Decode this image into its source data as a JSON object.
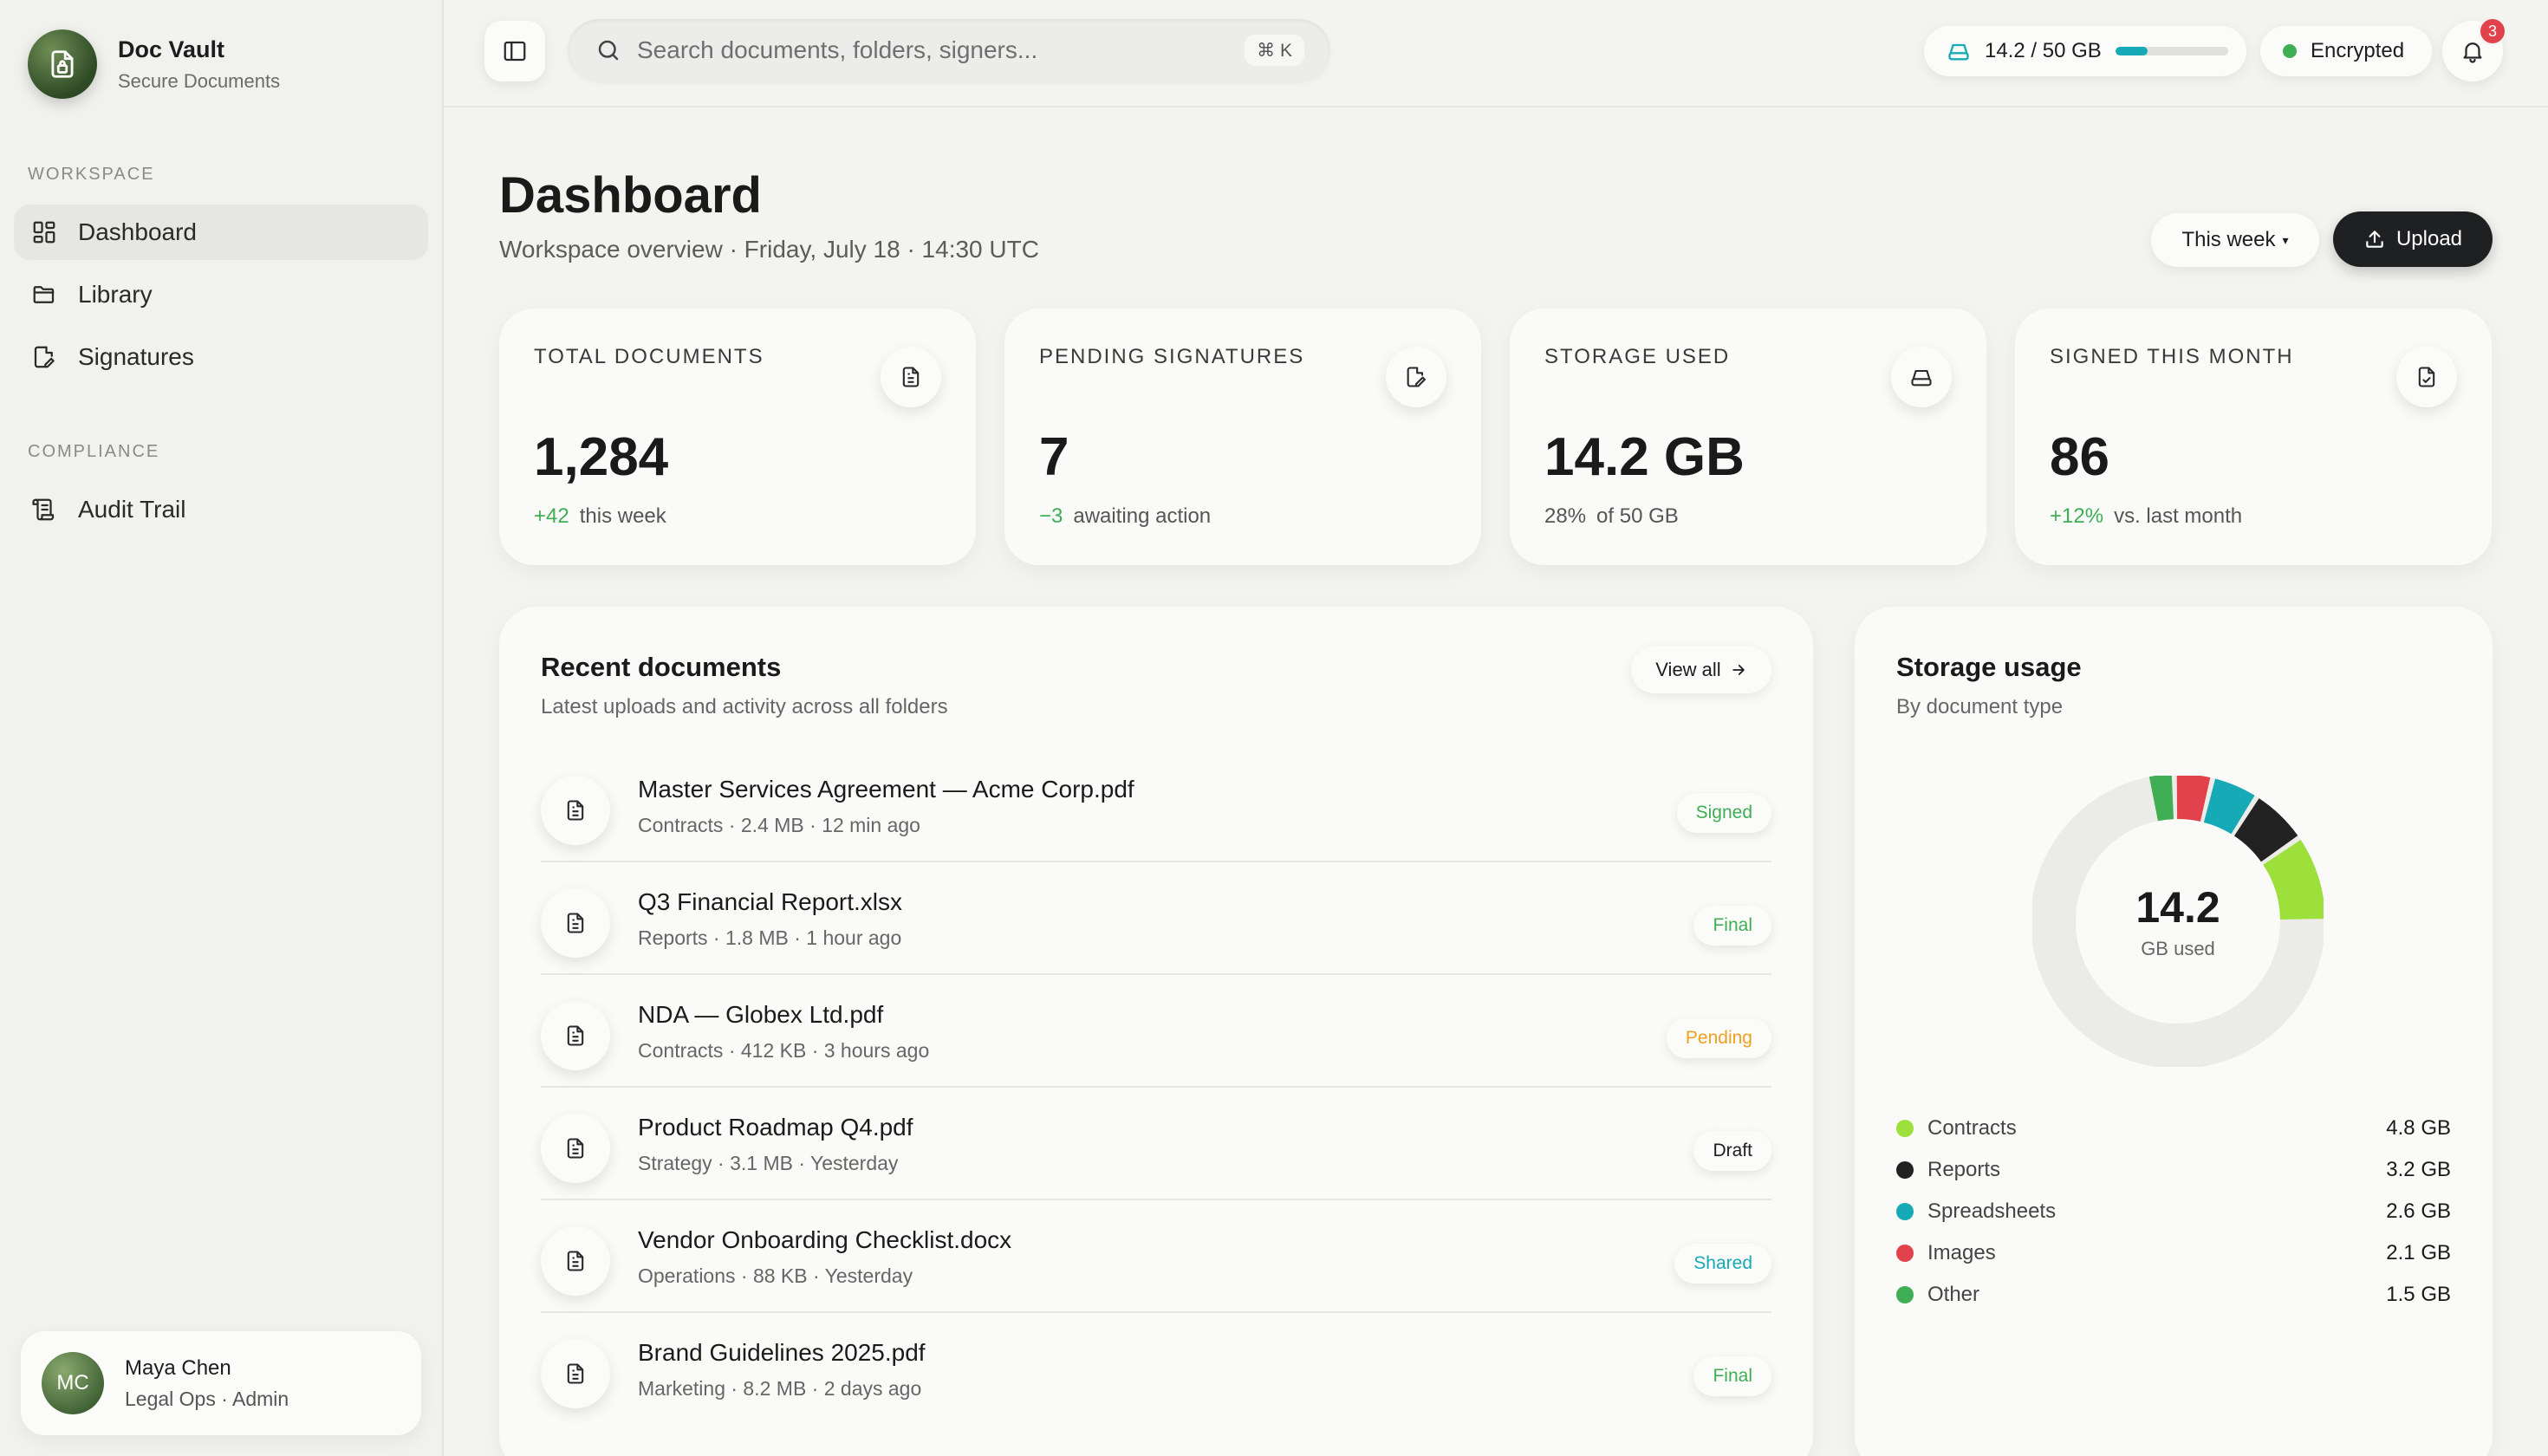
{
  "brand": {
    "name": "Doc Vault",
    "subtitle": "Secure Documents"
  },
  "sidebar": {
    "sections": [
      {
        "title": "WORKSPACE",
        "items": [
          {
            "label": "Dashboard",
            "icon": "grid-icon",
            "active": true
          },
          {
            "label": "Library",
            "icon": "folder-icon",
            "active": false
          },
          {
            "label": "Signatures",
            "icon": "signature-icon",
            "active": false
          }
        ]
      },
      {
        "title": "COMPLIANCE",
        "items": [
          {
            "label": "Audit Trail",
            "icon": "scroll-icon",
            "active": false
          }
        ]
      }
    ]
  },
  "user": {
    "initials": "MC",
    "name": "Maya Chen",
    "role": "Legal Ops · Admin"
  },
  "topbar": {
    "search_placeholder": "Search documents, folders, signers...",
    "shortcut": "⌘ K",
    "storage_text": "14.2 / 50 GB",
    "storage_fraction": 0.284,
    "encryption": "Encrypted",
    "notification_count": "3"
  },
  "header": {
    "title": "Dashboard",
    "subtitle": "Workspace overview · Friday, July 18 · 14:30 UTC",
    "period": "This week",
    "upload": "Upload"
  },
  "stats": [
    {
      "label": "TOTAL DOCUMENTS",
      "value": "1,284",
      "delta": "+42",
      "note": "this week",
      "icon": "document-icon"
    },
    {
      "label": "PENDING SIGNATURES",
      "value": "7",
      "delta": "−3",
      "note": "awaiting action",
      "icon": "pen-document-icon"
    },
    {
      "label": "STORAGE USED",
      "value": "14.2 GB",
      "delta": "28%",
      "note": "of 50 GB",
      "icon": "drive-icon"
    },
    {
      "label": "SIGNED THIS MONTH",
      "value": "86",
      "delta": "+12%",
      "note": "vs. last month",
      "icon": "signed-document-icon"
    }
  ],
  "recent": {
    "title": "Recent documents",
    "subtitle": "Latest uploads and activity across all folders",
    "view_all": "View all",
    "rows": [
      {
        "name": "Master Services Agreement — Acme Corp.pdf",
        "meta": "Contracts · 2.4 MB · 12 min ago",
        "status": "Signed",
        "status_color": "#3fae55"
      },
      {
        "name": "Q3 Financial Report.xlsx",
        "meta": "Reports · 1.8 MB · 1 hour ago",
        "status": "Final",
        "status_color": "#3fae55"
      },
      {
        "name": "NDA — Globex Ltd.pdf",
        "meta": "Contracts · 412 KB · 3 hours ago",
        "status": "Pending",
        "status_color": "#f0a020"
      },
      {
        "name": "Product Roadmap Q4.pdf",
        "meta": "Strategy · 3.1 MB · Yesterday",
        "status": "Draft",
        "status_color": "#1d1d1f"
      },
      {
        "name": "Vendor Onboarding Checklist.docx",
        "meta": "Operations · 88 KB · Yesterday",
        "status": "Shared",
        "status_color": "#16aab6"
      },
      {
        "name": "Brand Guidelines 2025.pdf",
        "meta": "Marketing · 8.2 MB · 2 days ago",
        "status": "Final",
        "status_color": "#3fae55"
      }
    ]
  },
  "storage_usage": {
    "title": "Storage usage",
    "subtitle": "By document type",
    "center_value": "14.2",
    "center_unit": "GB used",
    "total_gb": 50,
    "segments": [
      {
        "name": "Contracts",
        "value": "4.8 GB",
        "gb": 4.8,
        "color": "#9ee03b"
      },
      {
        "name": "Reports",
        "value": "3.2 GB",
        "gb": 3.2,
        "color": "#222222"
      },
      {
        "name": "Spreadsheets",
        "value": "2.6 GB",
        "gb": 2.6,
        "color": "#16aab6"
      },
      {
        "name": "Images",
        "value": "2.1 GB",
        "gb": 2.1,
        "color": "#e2424c"
      },
      {
        "name": "Other",
        "value": "1.5 GB",
        "gb": 1.5,
        "color": "#3fae55"
      }
    ]
  }
}
